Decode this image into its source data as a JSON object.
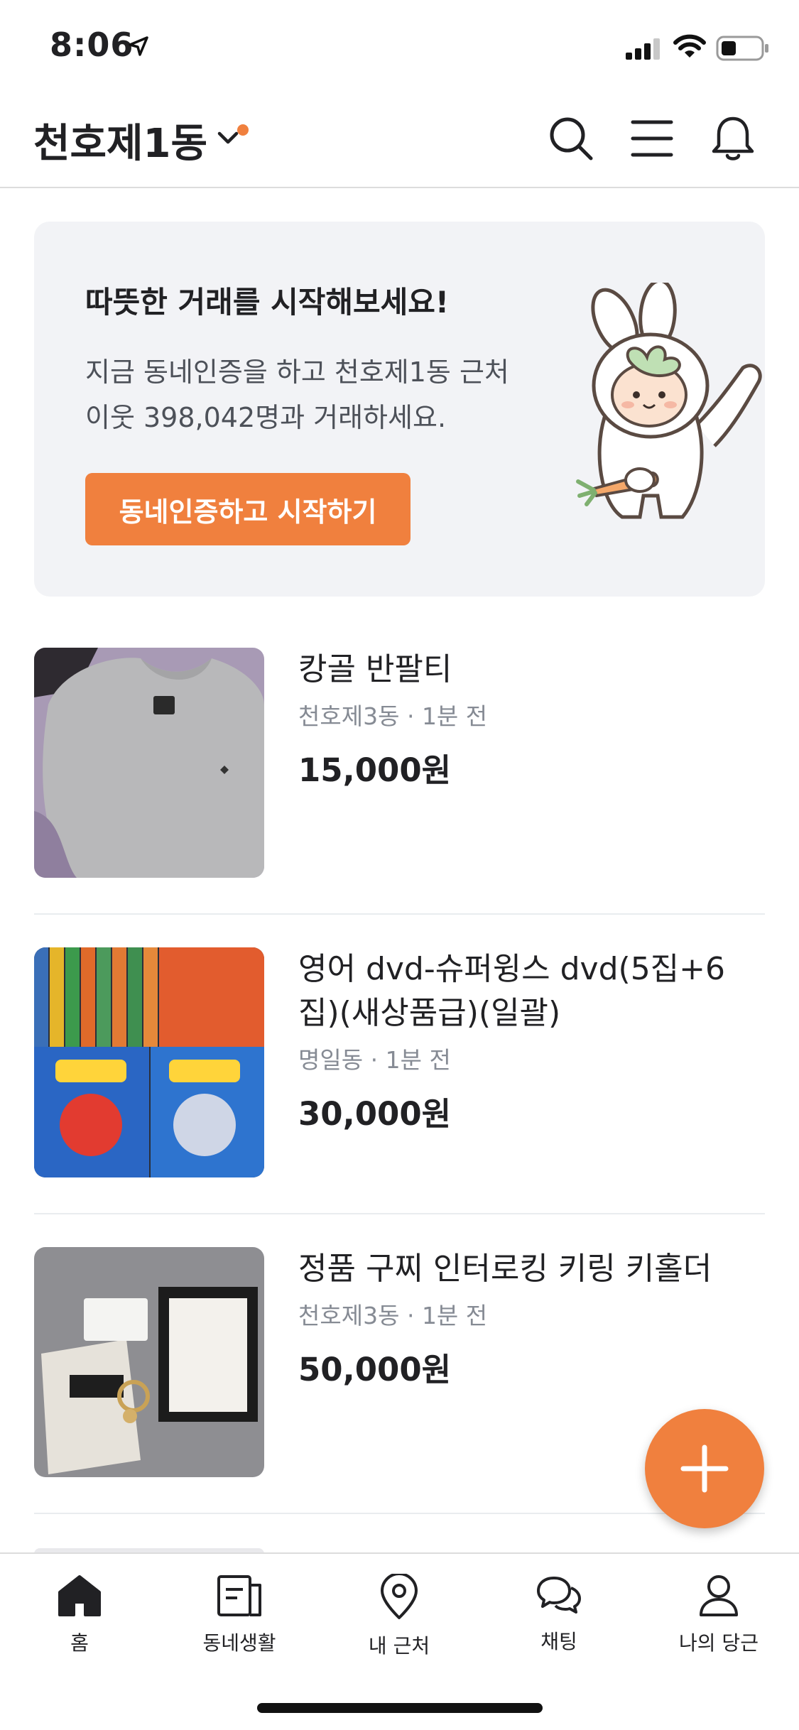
{
  "status_bar": {
    "time": "8:06"
  },
  "header": {
    "location": "천호제1동"
  },
  "banner": {
    "title": "따뜻한 거래를 시작해보세요!",
    "description": "지금 동네인증을 하고 천호제1동 근처 이웃 398,042명과 거래하세요.",
    "button_label": "동네인증하고 시작하기"
  },
  "items": [
    {
      "title": "캉골 반팔티",
      "location": "천호제3동",
      "time": "1분 전",
      "price": "15,000원"
    },
    {
      "title": "영어 dvd-슈퍼윙스 dvd(5집+6집)(새상품급)(일괄)",
      "location": "명일동",
      "time": "1분 전",
      "price": "30,000원"
    },
    {
      "title": "정품 구찌 인터로킹 키링 키홀더",
      "location": "천호제3동",
      "time": "1분 전",
      "price": "50,000원"
    }
  ],
  "meta_separator": "·",
  "nav": {
    "items": [
      {
        "label": "홈"
      },
      {
        "label": "동네생활"
      },
      {
        "label": "내 근처"
      },
      {
        "label": "채팅"
      },
      {
        "label": "나의 당근"
      }
    ]
  },
  "colors": {
    "accent": "#f0803e",
    "banner_bg": "#f2f3f6",
    "meta_text": "#868b94"
  },
  "icons": [
    "location-arrow-icon",
    "cellular-signal-icon",
    "wifi-icon",
    "battery-icon",
    "chevron-down-icon",
    "search-icon",
    "menu-icon",
    "bell-icon",
    "plus-icon",
    "home-icon",
    "community-icon",
    "map-pin-icon",
    "chat-icon",
    "person-icon"
  ]
}
